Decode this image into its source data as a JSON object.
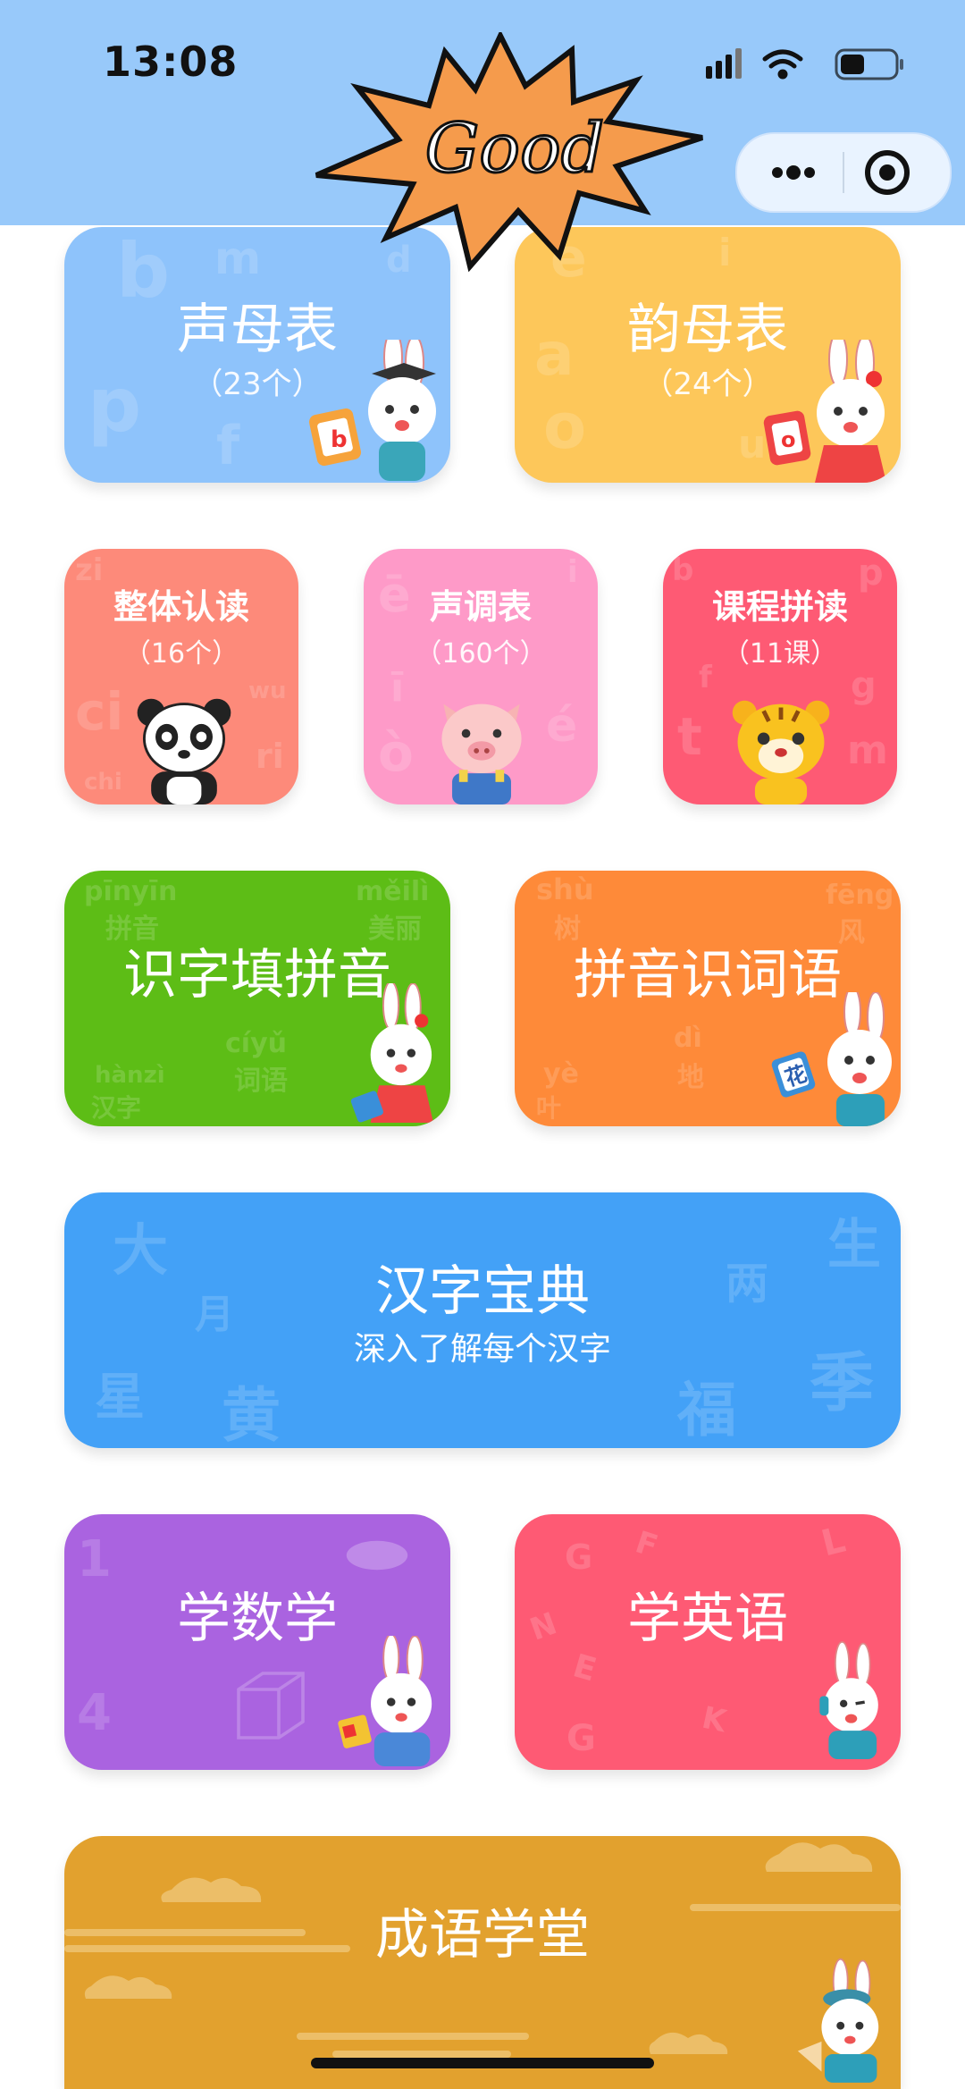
{
  "status_bar": {
    "time": "13:08"
  },
  "header": {
    "badge_text": "Good"
  },
  "colors": {
    "header_bg": "#98c9fa",
    "shengmu": "#8ec3fb",
    "yunmu": "#fdc75a",
    "zhengti": "#fd8a7a",
    "shengdiao": "#fe9ac8",
    "kecheng": "#fe5a74",
    "shizi": "#5dbd16",
    "pinyin": "#fe8a39",
    "hanzi": "#43a1f7",
    "math": "#aa63e0",
    "english": "#fe5a74",
    "idiom": "#e2a12e"
  },
  "cards": {
    "shengmu": {
      "title": "声母表",
      "sub": "（23个）",
      "letters": [
        "b",
        "m",
        "d",
        "p",
        "f"
      ]
    },
    "yunmu": {
      "title": "韵母表",
      "sub": "（24个）",
      "letters": [
        "e",
        "i",
        "a",
        "o",
        "u"
      ]
    },
    "zhengti": {
      "title": "整体认读",
      "sub": "（16个）",
      "letters": [
        "zi",
        "ci",
        "wu",
        "ri",
        "chi"
      ]
    },
    "shengdiao": {
      "title": "声调表",
      "sub": "（160个）",
      "letters": [
        "ē",
        "ī",
        "ò",
        "é",
        "i"
      ]
    },
    "kecheng": {
      "title": "课程拼读",
      "sub": "（11课）",
      "letters": [
        "b",
        "p",
        "f",
        "t",
        "g",
        "m"
      ]
    },
    "shizi": {
      "title": "识字填拼音",
      "words": [
        "pīnyīn",
        "拼音",
        "měilì",
        "美丽",
        "cíyǔ",
        "词语",
        "hànzì",
        "汉字"
      ]
    },
    "pinyin": {
      "title": "拼音识词语",
      "words": [
        "shù",
        "树",
        "fēng",
        "风",
        "dì",
        "地",
        "yè",
        "叶"
      ],
      "card_char": "花"
    },
    "hanzi": {
      "title": "汉字宝典",
      "sub": "深入了解每个汉字",
      "chars": [
        "大",
        "月",
        "星",
        "黄",
        "生",
        "两",
        "季",
        "福"
      ]
    },
    "math": {
      "title": "学数学",
      "numbers": [
        "1",
        "4"
      ]
    },
    "english": {
      "title": "学英语",
      "letters": [
        "G",
        "F",
        "L",
        "N",
        "E",
        "K",
        "G"
      ]
    },
    "idiom": {
      "title": "成语学堂"
    }
  }
}
